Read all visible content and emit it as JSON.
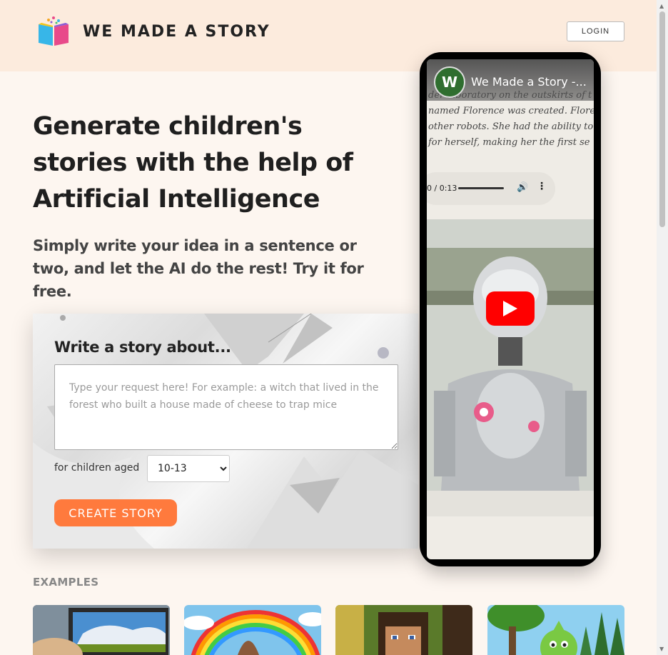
{
  "header": {
    "brand": "WE MADE A STORY",
    "login_label": "LOGIN",
    "logo_icon": "open-book-icon"
  },
  "hero": {
    "title": "Generate children's stories with the help of Artificial Intelligence",
    "subtitle": "Simply write your idea in a sentence or two, and let the AI do the rest! Try it for free."
  },
  "form": {
    "title": "Write a story about...",
    "placeholder": "Type your request here! For example: a witch that lived in the forest who built a house made of cheese to trap mice",
    "age_label": "for children aged",
    "age_selected": "10-13",
    "create_label": "CREATE STORY"
  },
  "examples": {
    "label": "EXAMPLES"
  },
  "video": {
    "channel_initial": "W",
    "title": "We Made a Story -...",
    "story_lines": [
      "der laboratory on the outskirts of t",
      "named Florence was created. Floren",
      "other robots. She had the ability to",
      " for herself, making her the first se"
    ],
    "audio_time": "0 / 0:13",
    "play_icon": "youtube-play-icon"
  },
  "colors": {
    "accent": "#ff7a3d",
    "header_bg": "#fcebdd",
    "play_red": "#ff0000"
  }
}
